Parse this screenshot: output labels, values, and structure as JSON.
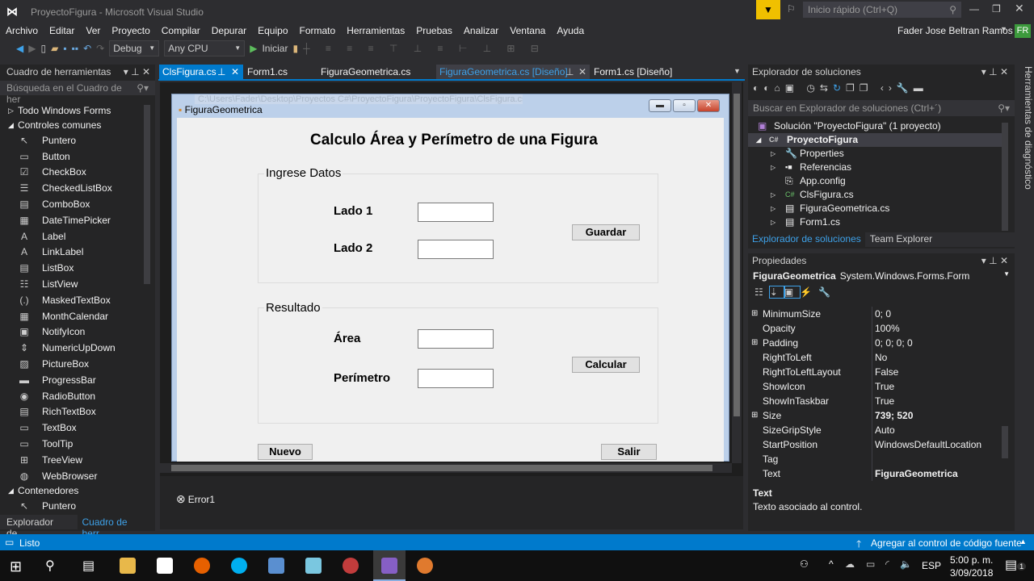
{
  "window": {
    "title": "ProyectoFigura - Microsoft Visual Studio",
    "quick_launch": "Inicio rápido (Ctrl+Q)",
    "user": "Fader Jose Beltran Ramos",
    "user_initials": "FR"
  },
  "menu": [
    "Archivo",
    "Editar",
    "Ver",
    "Proyecto",
    "Compilar",
    "Depurar",
    "Equipo",
    "Formato",
    "Herramientas",
    "Pruebas",
    "Analizar",
    "Ventana",
    "Ayuda"
  ],
  "toolbar": {
    "config": "Debug",
    "platform": "Any CPU",
    "start": "Iniciar"
  },
  "toolbox": {
    "title": "Cuadro de herramientas",
    "search_placeholder": "Búsqueda en el Cuadro de her",
    "groups": [
      "Todo Windows Forms",
      "Controles comunes",
      "Contenedores"
    ],
    "items": [
      {
        "icon": "pointer-icon",
        "g": "↖",
        "label": "Puntero"
      },
      {
        "icon": "button-icon",
        "g": "▭",
        "label": "Button"
      },
      {
        "icon": "checkbox-icon",
        "g": "☑",
        "label": "CheckBox"
      },
      {
        "icon": "checkedlistbox-icon",
        "g": "☰",
        "label": "CheckedListBox"
      },
      {
        "icon": "combobox-icon",
        "g": "▤",
        "label": "ComboBox"
      },
      {
        "icon": "datetimepicker-icon",
        "g": "▦",
        "label": "DateTimePicker"
      },
      {
        "icon": "label-icon",
        "g": "A",
        "label": "Label"
      },
      {
        "icon": "linklabel-icon",
        "g": "A",
        "label": "LinkLabel"
      },
      {
        "icon": "listbox-icon",
        "g": "▤",
        "label": "ListBox"
      },
      {
        "icon": "listview-icon",
        "g": "☷",
        "label": "ListView"
      },
      {
        "icon": "maskedtextbox-icon",
        "g": "(.)",
        "label": "MaskedTextBox"
      },
      {
        "icon": "monthcalendar-icon",
        "g": "▦",
        "label": "MonthCalendar"
      },
      {
        "icon": "notifyicon-icon",
        "g": "▣",
        "label": "NotifyIcon"
      },
      {
        "icon": "numericupdown-icon",
        "g": "⇕",
        "label": "NumericUpDown"
      },
      {
        "icon": "picturebox-icon",
        "g": "▨",
        "label": "PictureBox"
      },
      {
        "icon": "progressbar-icon",
        "g": "▬",
        "label": "ProgressBar"
      },
      {
        "icon": "radiobutton-icon",
        "g": "◉",
        "label": "RadioButton"
      },
      {
        "icon": "richtextbox-icon",
        "g": "▤",
        "label": "RichTextBox"
      },
      {
        "icon": "textbox-icon",
        "g": "▭",
        "label": "TextBox"
      },
      {
        "icon": "tooltip-icon",
        "g": "▭",
        "label": "ToolTip"
      },
      {
        "icon": "treeview-icon",
        "g": "⊞",
        "label": "TreeView"
      },
      {
        "icon": "webbrowser-icon",
        "g": "◍",
        "label": "WebBrowser"
      }
    ],
    "container_items": [
      "Puntero"
    ],
    "bottom_tabs": [
      "Explorador de...",
      "Cuadro de herr..."
    ]
  },
  "tabs": [
    {
      "label": "ClsFigura.cs",
      "active": true
    },
    {
      "label": "Form1.cs"
    },
    {
      "label": "FiguraGeometrica.cs"
    },
    {
      "label": "FiguraGeometrica.cs [Diseño]",
      "selected": true
    },
    {
      "label": "Form1.cs [Diseño]"
    }
  ],
  "tooltip_path": "C:\\Users\\Fader\\Desktop\\Proyectos C#\\ProyectoFigura\\ProyectoFigura\\ClsFigura.cs",
  "form": {
    "title": "FiguraGeometrica",
    "heading": "Calculo Área y Perímetro de una Figura",
    "group1": "Ingrese Datos",
    "lado1": "Lado 1",
    "lado2": "Lado 2",
    "guardar": "Guardar",
    "group2": "Resultado",
    "area": "Área",
    "perimetro": "Perímetro",
    "calcular": "Calcular",
    "nuevo": "Nuevo",
    "salir": "Salir"
  },
  "tray": {
    "error": "Error1"
  },
  "solution": {
    "title": "Explorador de soluciones",
    "search_placeholder": "Buscar en Explorador de soluciones (Ctrl+´)",
    "solution": "Solución \"ProyectoFigura\"  (1 proyecto)",
    "project": "ProyectoFigura",
    "items": [
      "Properties",
      "Referencias",
      "App.config",
      "ClsFigura.cs",
      "FiguraGeometrica.cs",
      "Form1.cs"
    ],
    "tabs": [
      "Explorador de soluciones",
      "Team Explorer"
    ]
  },
  "side_tab": "Herramientas de diagnóstico",
  "properties": {
    "title": "Propiedades",
    "object": "FiguraGeometrica",
    "type": "System.Windows.Forms.Form",
    "rows": [
      {
        "n": "MinimumSize",
        "v": "0; 0",
        "exp": true
      },
      {
        "n": "Opacity",
        "v": "100%"
      },
      {
        "n": "Padding",
        "v": "0; 0; 0; 0",
        "exp": true
      },
      {
        "n": "RightToLeft",
        "v": "No"
      },
      {
        "n": "RightToLeftLayout",
        "v": "False"
      },
      {
        "n": "ShowIcon",
        "v": "True"
      },
      {
        "n": "ShowInTaskbar",
        "v": "True"
      },
      {
        "n": "Size",
        "v": "739; 520",
        "exp": true,
        "bold": true
      },
      {
        "n": "SizeGripStyle",
        "v": "Auto"
      },
      {
        "n": "StartPosition",
        "v": "WindowsDefaultLocation"
      },
      {
        "n": "Tag",
        "v": ""
      },
      {
        "n": "Text",
        "v": "FiguraGeometrica",
        "bold": true
      }
    ],
    "desc_title": "Text",
    "desc": "Texto asociado al control."
  },
  "status": {
    "left": "Listo",
    "right": "Agregar al control de código fuente"
  },
  "taskbar": {
    "lang": "ESP",
    "time": "5:00 p. m.",
    "date": "3/09/2018",
    "notif": "1"
  }
}
